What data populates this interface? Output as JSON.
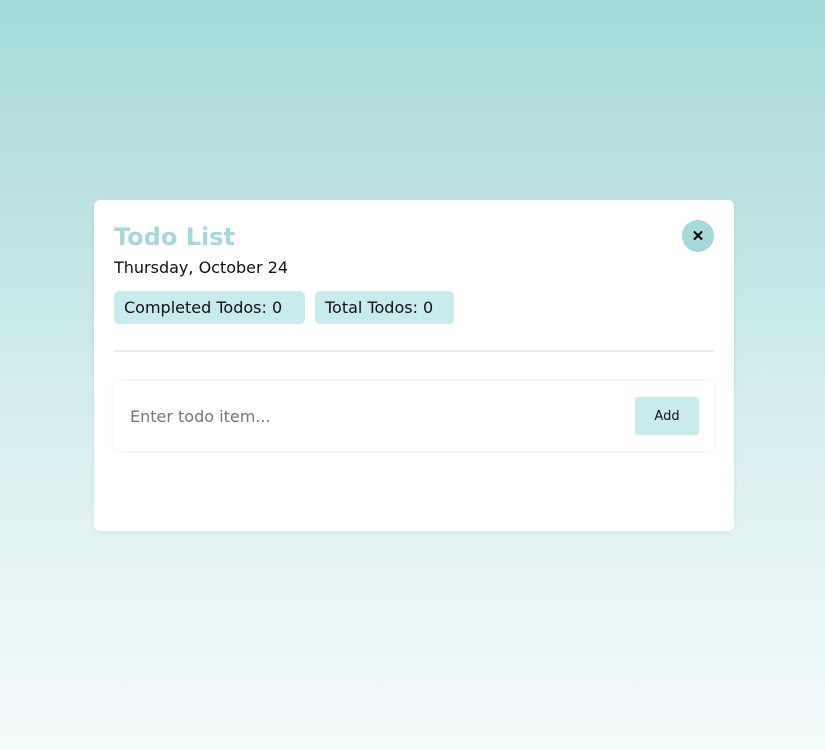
{
  "card": {
    "title": "Todo List",
    "close_symbol": "✕",
    "date": "Thursday, October 24"
  },
  "stats": {
    "completed_label": "Completed Todos: 0",
    "completed_count": 0,
    "total_label": "Total Todos: 0",
    "total_count": 0
  },
  "input": {
    "value": "",
    "placeholder": "Enter todo item..."
  },
  "add_button": {
    "label": "Add"
  },
  "colors": {
    "accent": "#a6d9da",
    "title": "#a5d9db",
    "badge": "#c8ebed"
  },
  "icons": {
    "close": "close-icon"
  }
}
